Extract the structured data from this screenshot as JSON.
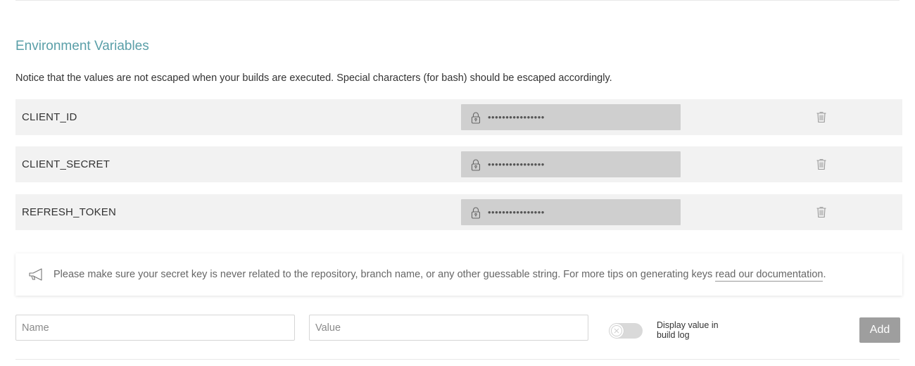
{
  "section": {
    "title": "Environment Variables",
    "notice": "Notice that the values are not escaped when your builds are executed. Special characters (for bash) should be escaped accordingly."
  },
  "variables": [
    {
      "name": "CLIENT_ID",
      "masked_value": "••••••••••••••••"
    },
    {
      "name": "CLIENT_SECRET",
      "masked_value": "••••••••••••••••"
    },
    {
      "name": "REFRESH_TOKEN",
      "masked_value": "••••••••••••••••"
    }
  ],
  "tip": {
    "text": "Please make sure your secret key is never related to the repository, branch name, or any other guessable string. For more tips on generating keys ",
    "link_text": "read our documentation",
    "trailing": "."
  },
  "form": {
    "name_placeholder": "Name",
    "value_placeholder": "Value",
    "toggle_label": "Display value in build log",
    "add_label": "Add"
  },
  "colors": {
    "accent": "#5a9fa8",
    "row_background": "#f2f2f2",
    "value_background": "#cfcfcf",
    "add_button": "#9e9e9e"
  },
  "icons": [
    "lock-icon",
    "trash-icon",
    "megaphone-icon",
    "toggle-off-x-icon"
  ]
}
